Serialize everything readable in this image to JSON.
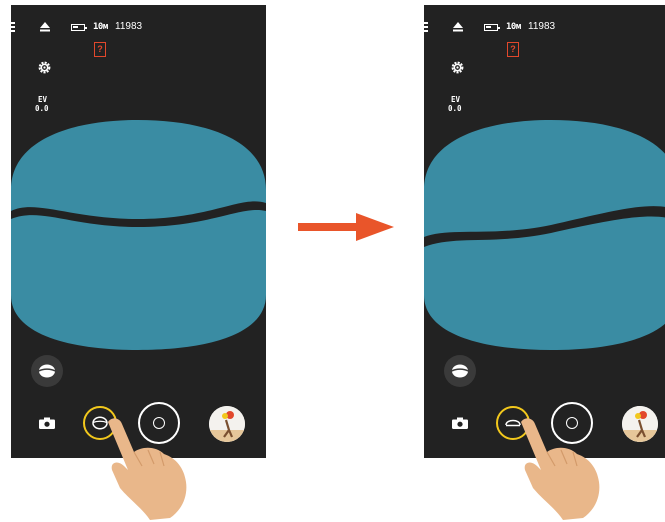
{
  "colors": {
    "screen_bg": "#222222",
    "panorama": "#3a8ca3",
    "lens_ring": "#f2c81c",
    "warning": "#e2482c",
    "arrow": "#e9552a",
    "hand": "#e9b78a"
  },
  "left_phone": {
    "status": {
      "resolution": "10м",
      "shots_remaining": "11983",
      "sd_warning": "?"
    },
    "ev": {
      "label": "EV",
      "value": "0.0"
    },
    "icons": [
      "menu-icon",
      "eject-icon",
      "battery-icon",
      "sd-card-warning-icon",
      "settings-icon",
      "lens-mode-icon",
      "camera-icon",
      "shutter-icon",
      "gallery-thumbnail"
    ],
    "lens_mode": "dual"
  },
  "right_phone": {
    "status": {
      "resolution": "10м",
      "shots_remaining": "11983",
      "sd_warning": "?"
    },
    "ev": {
      "label": "EV",
      "value": "0.0"
    },
    "icons": [
      "menu-icon",
      "eject-icon",
      "battery-icon",
      "sd-card-warning-icon",
      "settings-icon",
      "lens-mode-icon",
      "camera-icon",
      "shutter-icon",
      "gallery-thumbnail"
    ],
    "lens_mode": "dual-switched"
  },
  "transition_arrow": "right-arrow"
}
